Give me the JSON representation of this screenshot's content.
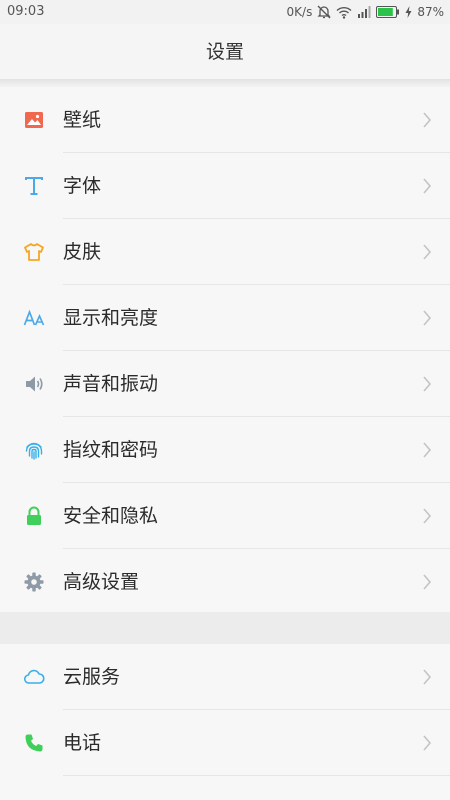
{
  "status": {
    "time": "09:03",
    "speed": "0K/s",
    "battery": "87%",
    "battery_level": 0.87
  },
  "header": {
    "title": "设置"
  },
  "groups": [
    {
      "items": [
        {
          "label": "壁纸",
          "icon": "wallpaper-icon",
          "icon_color": "#f0694f"
        },
        {
          "label": "字体",
          "icon": "font-icon",
          "icon_color": "#4aa9e9"
        },
        {
          "label": "皮肤",
          "icon": "theme-shirt-icon",
          "icon_color": "#f5a623"
        },
        {
          "label": "显示和亮度",
          "icon": "display-brightness-icon",
          "icon_color": "#4aa9e9"
        },
        {
          "label": "声音和振动",
          "icon": "speaker-icon",
          "icon_color": "#8e9aa5"
        },
        {
          "label": "指纹和密码",
          "icon": "fingerprint-icon",
          "icon_color": "#3ab0e8"
        },
        {
          "label": "安全和隐私",
          "icon": "lock-icon",
          "icon_color": "#3fcf5a"
        },
        {
          "label": "高级设置",
          "icon": "gear-icon",
          "icon_color": "#8e9aa5"
        }
      ]
    },
    {
      "items": [
        {
          "label": "云服务",
          "icon": "cloud-icon",
          "icon_color": "#3ab0e8"
        },
        {
          "label": "电话",
          "icon": "phone-icon",
          "icon_color": "#3fcf5a"
        }
      ]
    }
  ]
}
